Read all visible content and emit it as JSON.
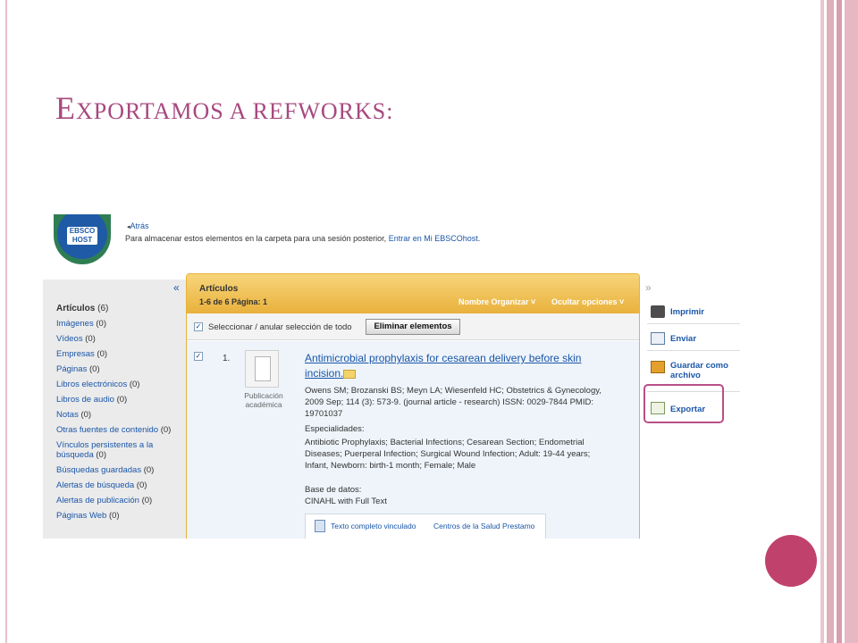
{
  "slide": {
    "title_first_letter": "E",
    "title_rest": "XPORTAMOS A REFWORKS:"
  },
  "header": {
    "logo_text": "EBSCO HOST",
    "back_label": "Atrás",
    "info_text": "Para almacenar estos elementos en la carpeta para una sesión posterior,",
    "info_link": "Entrar en Mi EBSCOhost",
    "info_end": "."
  },
  "sidebar": {
    "collapse_label": "«",
    "items": [
      {
        "label": "Artículos",
        "count": "(6)",
        "active": true
      },
      {
        "label": "Imágenes",
        "count": "(0)"
      },
      {
        "label": "Vídeos",
        "count": "(0)"
      },
      {
        "label": "Empresas",
        "count": "(0)"
      },
      {
        "label": "Páginas",
        "count": "(0)"
      },
      {
        "label": "Libros electrónicos",
        "count": "(0)"
      },
      {
        "label": "Libros de audio",
        "count": "(0)"
      },
      {
        "label": "Notas",
        "count": "(0)"
      },
      {
        "label": "Otras fuentes de contenido",
        "count": "(0)"
      },
      {
        "label": "Vínculos persistentes a la búsqueda",
        "count": "(0)"
      },
      {
        "label": "Búsquedas guardadas",
        "count": "(0)"
      },
      {
        "label": "Alertas de búsqueda",
        "count": "(0)"
      },
      {
        "label": "Alertas de publicación",
        "count": "(0)"
      },
      {
        "label": "Páginas Web",
        "count": "(0)"
      }
    ]
  },
  "main": {
    "title": "Artículos",
    "pagination": "1-6 de 6   Página: 1",
    "sort_label": "Nombre Organizar ˅",
    "hide_label": "Ocultar opciones ˅",
    "select_all_label": "Seleccionar / anular selección de todo",
    "remove_button": "Eliminar elementos"
  },
  "record": {
    "number": "1.",
    "doc_type": "Publicación académica",
    "title": "Antimicrobial prophylaxis for cesarean delivery before skin incision.",
    "meta": "Owens SM; Brozanski BS; Meyn LA; Wiesenfeld HC; Obstetrics & Gynecology, 2009 Sep; 114 (3): 573-9. (journal article - research) ISSN: 0029-7844 PMID: 19701037",
    "subjects_label": "Especialidades:",
    "subjects": "Antibiotic Prophylaxis; Bacterial Infections; Cesarean Section; Endometrial Diseases; Puerperal Infection; Surgical Wound Infection; Adult: 19-44 years; Infant, Newborn: birth-1 month; Female; Male",
    "database_label": "Base de datos:",
    "database": "CINAHL with Full Text",
    "fulltext_link": "Texto completo vinculado",
    "center_link": "Centros de la Salud Prestamo"
  },
  "actions": {
    "collapse_label": "»",
    "print": "Imprimir",
    "email": "Enviar",
    "save": "Guardar como archivo",
    "export": "Exportar"
  },
  "colors": {
    "title": "#a7497f",
    "accent_circle": "#c0426c",
    "highlight": "#b94f86",
    "link": "#1a56a8",
    "header_gold": "#e9b13c"
  }
}
